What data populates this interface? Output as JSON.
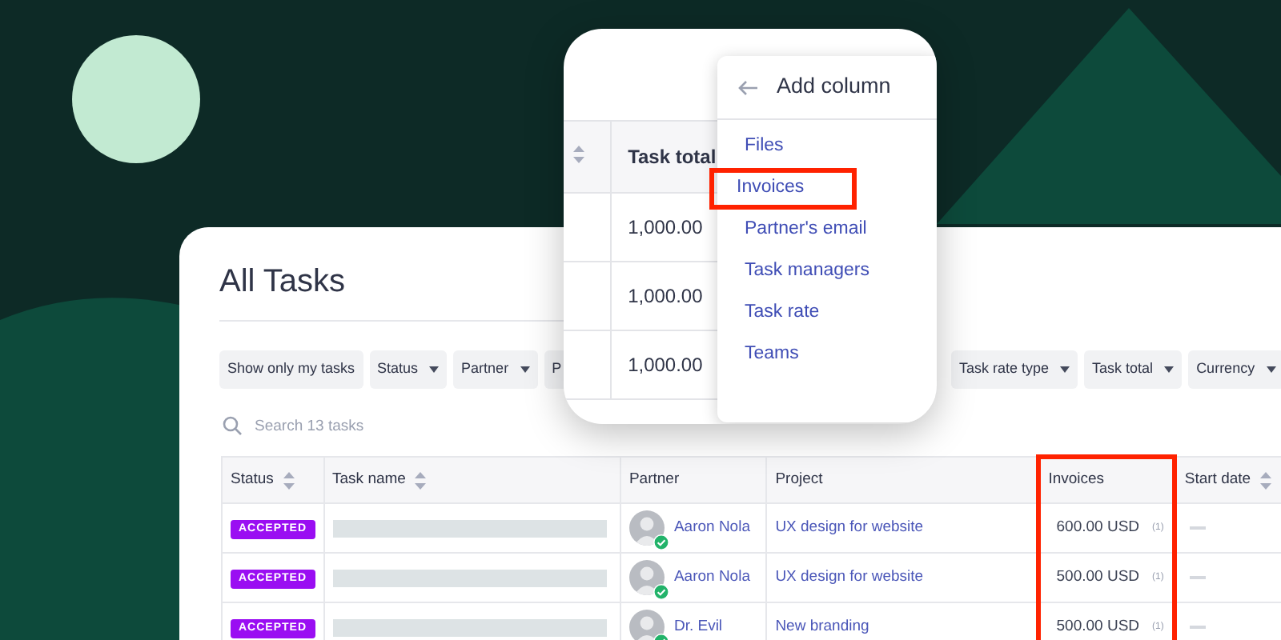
{
  "main_card": {
    "title": "All Tasks",
    "filters_left": [
      {
        "label": "Show only my tasks",
        "dropdown": false
      },
      {
        "label": "Status",
        "dropdown": true
      },
      {
        "label": "Partner",
        "dropdown": true
      },
      {
        "label": "P",
        "dropdown": false
      }
    ],
    "filters_right": [
      {
        "label": "Task rate type",
        "dropdown": true
      },
      {
        "label": "Task total",
        "dropdown": true
      },
      {
        "label": "Currency",
        "dropdown": true
      }
    ],
    "search": {
      "placeholder": "Search 13 tasks"
    },
    "table": {
      "columns": [
        {
          "label": "Status",
          "sortable": true,
          "highlighted": false
        },
        {
          "label": "Task name",
          "sortable": true,
          "highlighted": false
        },
        {
          "label": "Partner",
          "sortable": false,
          "highlighted": false
        },
        {
          "label": "Project",
          "sortable": false,
          "highlighted": false
        },
        {
          "label": "Invoices",
          "sortable": false,
          "highlighted": true
        },
        {
          "label": "Start date",
          "sortable": true,
          "highlighted": false
        }
      ],
      "rows": [
        {
          "status": "ACCEPTED",
          "partner": "Aaron Nola",
          "partner_verified": true,
          "project": "UX design for website",
          "invoice_amount": "600.00 USD",
          "invoice_count": "(1)"
        },
        {
          "status": "ACCEPTED",
          "partner": "Aaron Nola",
          "partner_verified": true,
          "project": "UX design for website",
          "invoice_amount": "500.00 USD",
          "invoice_count": "(1)"
        },
        {
          "status": "ACCEPTED",
          "partner": "Dr. Evil",
          "partner_verified": true,
          "project": "New branding",
          "invoice_amount": "500.00 USD",
          "invoice_count": "(1)"
        }
      ]
    }
  },
  "popup": {
    "column_header": "Task total",
    "cells": [
      "1,000.00",
      "1,000.00",
      "1,000.00"
    ],
    "menu": {
      "title": "Add column",
      "items": [
        {
          "label": "Files",
          "highlighted": false
        },
        {
          "label": "Invoices",
          "highlighted": true
        },
        {
          "label": "Partner's email",
          "highlighted": false
        },
        {
          "label": "Task managers",
          "highlighted": false
        },
        {
          "label": "Task rate",
          "highlighted": false
        },
        {
          "label": "Teams",
          "highlighted": false
        }
      ]
    }
  }
}
